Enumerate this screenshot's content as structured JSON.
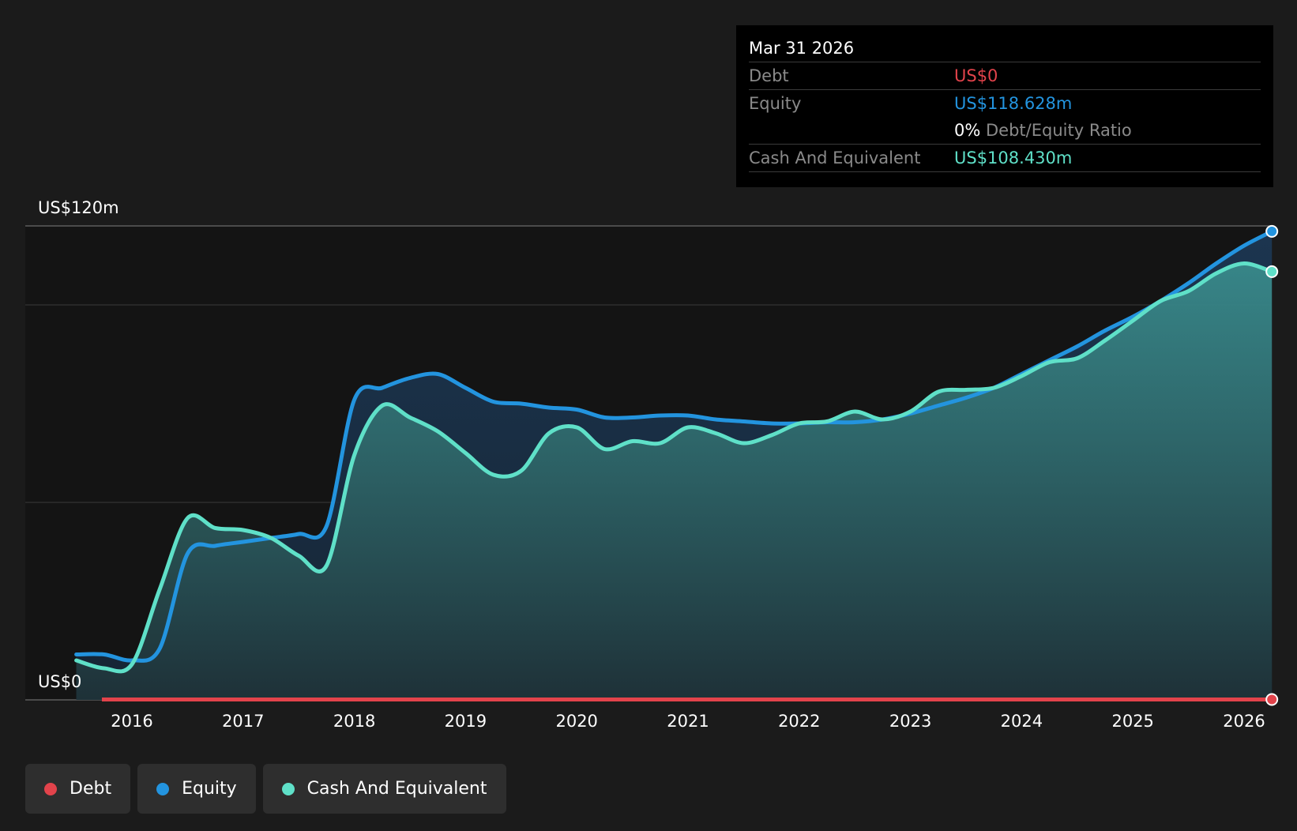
{
  "colors": {
    "debt": "#e2434b",
    "equity": "#2394df",
    "cash": "#5fe0c8",
    "background": "#1b1b1b"
  },
  "tooltip": {
    "date": "Mar 31 2026",
    "debt_label": "Debt",
    "debt_value": "US$0",
    "equity_label": "Equity",
    "equity_value": "US$118.628m",
    "ratio_value": "0%",
    "ratio_label": "Debt/Equity Ratio",
    "cash_label": "Cash And Equivalent",
    "cash_value": "US$108.430m"
  },
  "legend": {
    "debt": "Debt",
    "equity": "Equity",
    "cash": "Cash And Equivalent"
  },
  "chart_data": {
    "type": "area",
    "ylim": [
      0,
      120
    ],
    "y_tick_labels": [
      {
        "value": 120,
        "label": "US$120m"
      },
      {
        "value": 0,
        "label": "US$0"
      }
    ],
    "gridlines": [
      120,
      100,
      50,
      0
    ],
    "x_ticks": [
      2016,
      2017,
      2018,
      2019,
      2020,
      2021,
      2022,
      2023,
      2024,
      2025,
      2026
    ],
    "series": [
      {
        "name": "Debt",
        "key": "debt",
        "points": [
          [
            2015.73,
            0
          ],
          [
            2026.25,
            0
          ]
        ]
      },
      {
        "name": "Equity",
        "key": "equity",
        "points": [
          [
            2015.5,
            11.5
          ],
          [
            2015.75,
            11.5
          ],
          [
            2016.0,
            10.0
          ],
          [
            2016.25,
            13.0
          ],
          [
            2016.5,
            37.0
          ],
          [
            2016.75,
            39.0
          ],
          [
            2017.0,
            40.0
          ],
          [
            2017.25,
            41.0
          ],
          [
            2017.5,
            42.0
          ],
          [
            2017.75,
            44.0
          ],
          [
            2018.0,
            76.0
          ],
          [
            2018.25,
            79.0
          ],
          [
            2018.5,
            81.5
          ],
          [
            2018.75,
            82.5
          ],
          [
            2019.0,
            79.0
          ],
          [
            2019.25,
            75.5
          ],
          [
            2019.5,
            75.0
          ],
          [
            2019.75,
            74.0
          ],
          [
            2020.0,
            73.5
          ],
          [
            2020.25,
            71.5
          ],
          [
            2020.5,
            71.5
          ],
          [
            2020.75,
            72.0
          ],
          [
            2021.0,
            72.0
          ],
          [
            2021.25,
            71.0
          ],
          [
            2021.5,
            70.5
          ],
          [
            2021.75,
            70.0
          ],
          [
            2022.0,
            70.0
          ],
          [
            2022.25,
            70.3
          ],
          [
            2022.5,
            70.3
          ],
          [
            2022.75,
            71.0
          ],
          [
            2023.0,
            72.5
          ],
          [
            2023.25,
            74.5
          ],
          [
            2023.5,
            76.5
          ],
          [
            2023.75,
            79.0
          ],
          [
            2024.0,
            82.5
          ],
          [
            2024.25,
            86.0
          ],
          [
            2024.5,
            89.5
          ],
          [
            2024.75,
            93.5
          ],
          [
            2025.0,
            97.0
          ],
          [
            2025.25,
            101.0
          ],
          [
            2025.5,
            105.5
          ],
          [
            2025.75,
            110.5
          ],
          [
            2026.0,
            115.0
          ],
          [
            2026.25,
            118.628
          ]
        ]
      },
      {
        "name": "Cash And Equivalent",
        "key": "cash",
        "points": [
          [
            2015.5,
            10.0
          ],
          [
            2015.75,
            8.0
          ],
          [
            2016.0,
            9.0
          ],
          [
            2016.25,
            28.0
          ],
          [
            2016.5,
            46.0
          ],
          [
            2016.75,
            43.5
          ],
          [
            2017.0,
            43.0
          ],
          [
            2017.25,
            41.0
          ],
          [
            2017.5,
            36.5
          ],
          [
            2017.75,
            34.0
          ],
          [
            2018.0,
            62.0
          ],
          [
            2018.25,
            74.5
          ],
          [
            2018.5,
            71.5
          ],
          [
            2018.75,
            68.0
          ],
          [
            2019.0,
            62.5
          ],
          [
            2019.25,
            57.0
          ],
          [
            2019.5,
            58.0
          ],
          [
            2019.75,
            67.5
          ],
          [
            2020.0,
            69.0
          ],
          [
            2020.25,
            63.5
          ],
          [
            2020.5,
            65.5
          ],
          [
            2020.75,
            65.0
          ],
          [
            2021.0,
            69.0
          ],
          [
            2021.25,
            67.5
          ],
          [
            2021.5,
            65.0
          ],
          [
            2021.75,
            67.0
          ],
          [
            2022.0,
            70.0
          ],
          [
            2022.25,
            70.5
          ],
          [
            2022.5,
            73.0
          ],
          [
            2022.75,
            71.0
          ],
          [
            2023.0,
            73.0
          ],
          [
            2023.25,
            78.0
          ],
          [
            2023.5,
            78.5
          ],
          [
            2023.75,
            79.0
          ],
          [
            2024.0,
            82.0
          ],
          [
            2024.25,
            85.5
          ],
          [
            2024.5,
            86.5
          ],
          [
            2024.75,
            91.0
          ],
          [
            2025.0,
            96.0
          ],
          [
            2025.25,
            101.0
          ],
          [
            2025.5,
            103.5
          ],
          [
            2025.75,
            108.0
          ],
          [
            2026.0,
            110.5
          ],
          [
            2026.25,
            108.43
          ]
        ]
      }
    ]
  }
}
